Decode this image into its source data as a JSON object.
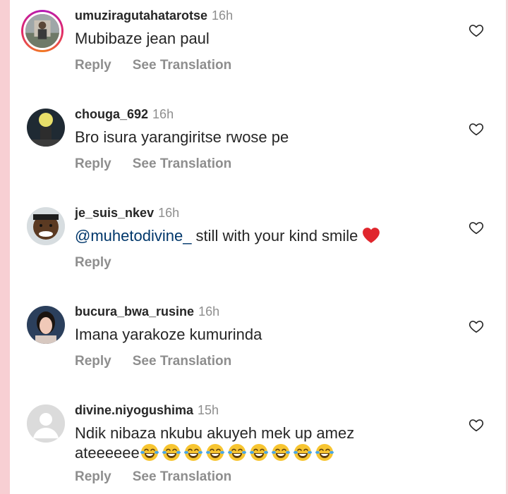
{
  "comments": [
    {
      "username": "umuziragutahatarotse",
      "time": "16h",
      "text": "Mubibaze jean paul",
      "reply_label": "Reply",
      "translate_label": "See Translation"
    },
    {
      "username": "chouga_692",
      "time": "16h",
      "text": "Bro isura yarangiritse rwose pe",
      "reply_label": "Reply",
      "translate_label": "See Translation"
    },
    {
      "username": "je_suis_nkev",
      "time": "16h",
      "mention": "@muhetodivine_",
      "text": " still with your kind smile",
      "reply_label": "Reply"
    },
    {
      "username": "bucura_bwa_rusine",
      "time": "16h",
      "text": "Imana yarakoze kumurinda",
      "reply_label": "Reply",
      "translate_label": "See Translation"
    },
    {
      "username": "divine.niyogushima",
      "time": "15h",
      "text_line1": "Ndik nibaza nkubu akuyeh mek up amez",
      "text_line2": "ateeeeee",
      "reply_label": "Reply",
      "translate_label": "See Translation"
    }
  ],
  "colors": {
    "username": "#262626",
    "muted": "#8e8e8e",
    "mention": "#00376b",
    "heart_emoji": "#e0262d",
    "left_strip": "#f7cfd3"
  },
  "icons": {
    "like": "heart-outline-icon",
    "emoji_heart": "red-heart-emoji",
    "emoji_laugh": "tears-of-joy-emoji"
  }
}
